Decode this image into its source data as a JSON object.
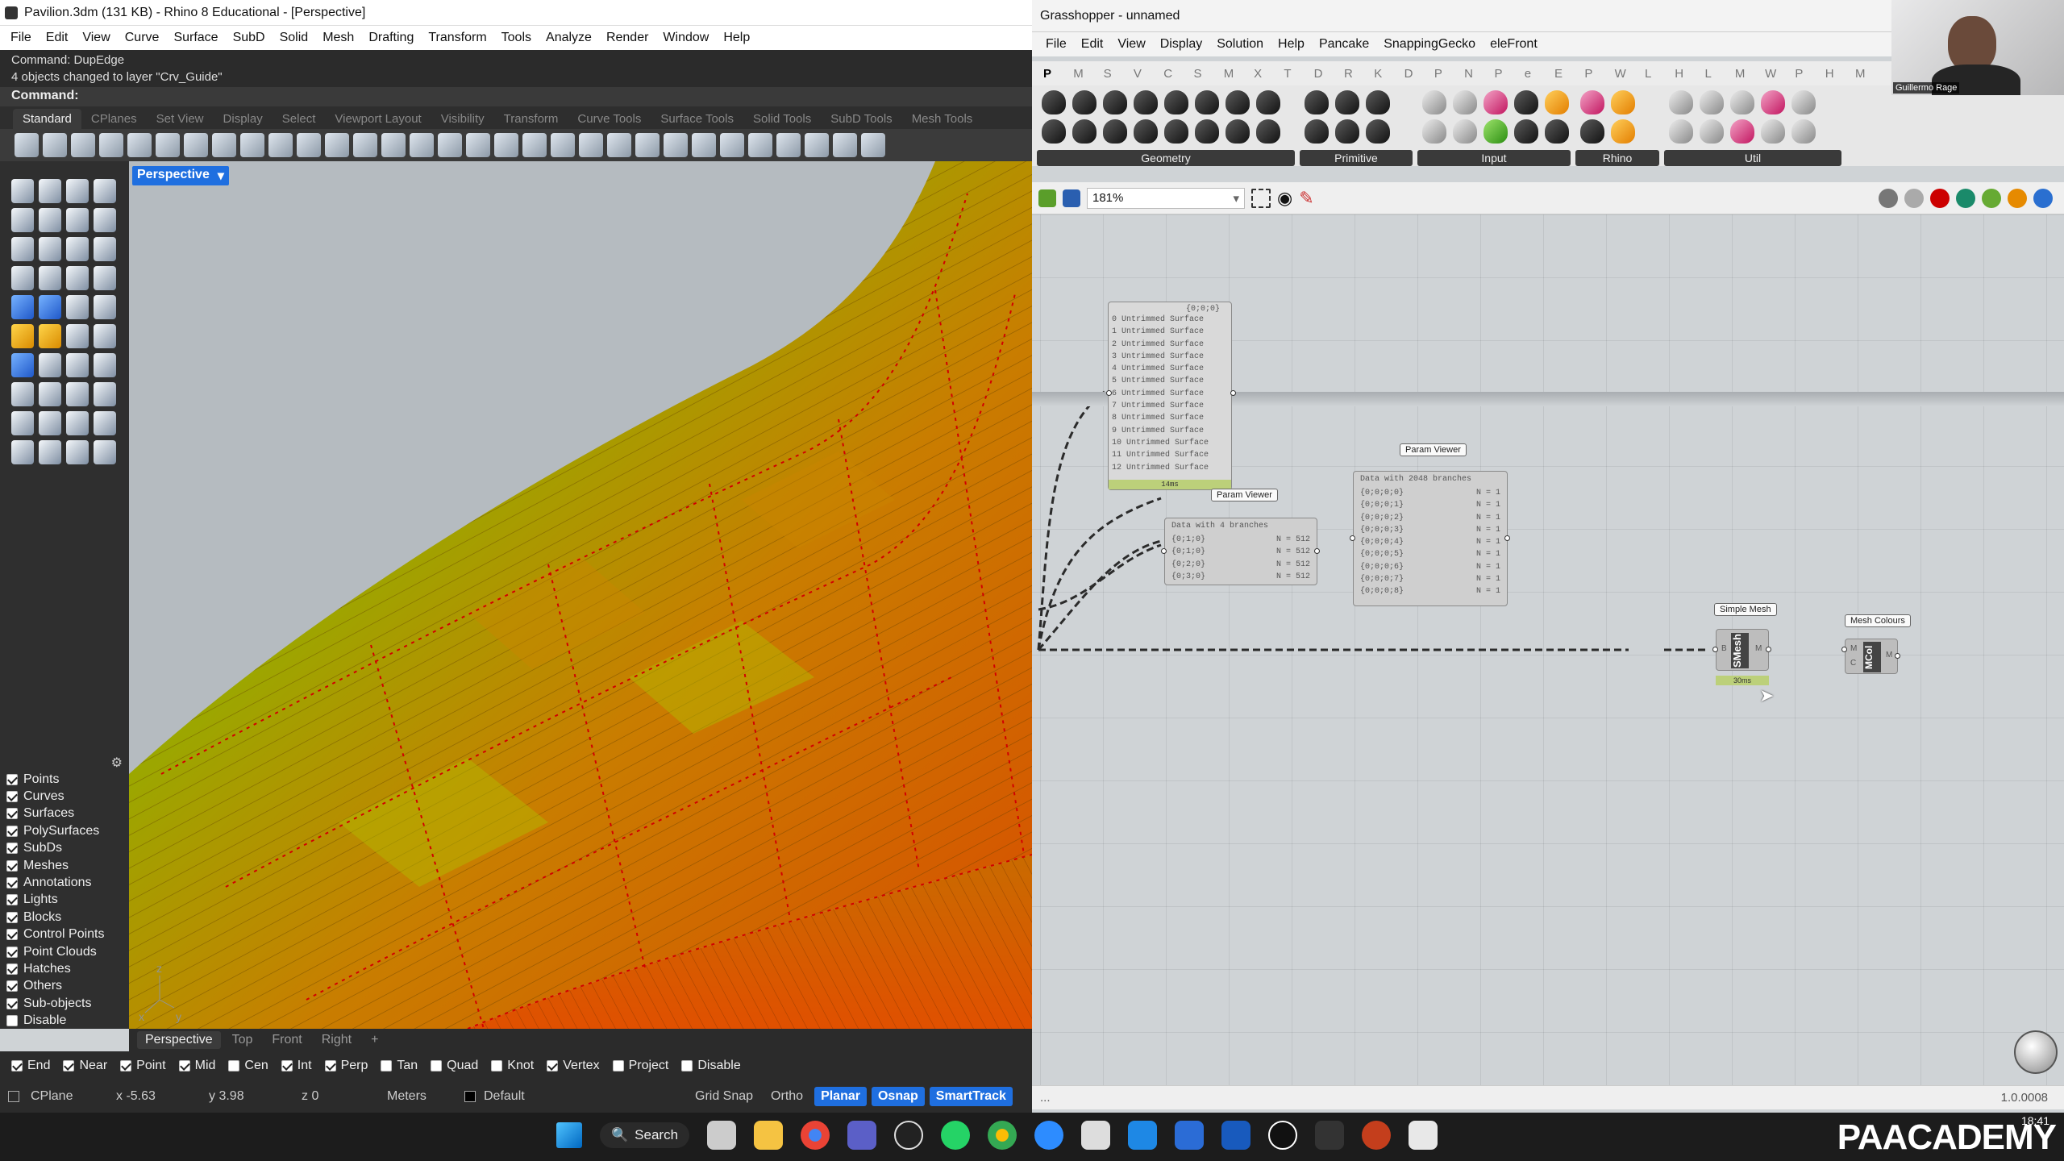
{
  "rhino": {
    "title": "Pavilion.3dm (131 KB) - Rhino 8 Educational - [Perspective]",
    "menu": [
      "File",
      "Edit",
      "View",
      "Curve",
      "Surface",
      "SubD",
      "Solid",
      "Mesh",
      "Drafting",
      "Transform",
      "Tools",
      "Analyze",
      "Render",
      "Window",
      "Help"
    ],
    "cmd_history": [
      "Command: DupEdge",
      "4 objects changed to layer \"Crv_Guide\""
    ],
    "cmd_prompt": "Command:",
    "toolbar_tabs": [
      "Standard",
      "CPlanes",
      "Set View",
      "Display",
      "Select",
      "Viewport Layout",
      "Visibility",
      "Transform",
      "Curve Tools",
      "Surface Tools",
      "Solid Tools",
      "SubD Tools",
      "Mesh Tools"
    ],
    "viewport_name": "Perspective",
    "viewport_tabs": [
      "Perspective",
      "Top",
      "Front",
      "Right",
      "+"
    ],
    "filters": [
      {
        "label": "Points",
        "on": true
      },
      {
        "label": "Curves",
        "on": true
      },
      {
        "label": "Surfaces",
        "on": true
      },
      {
        "label": "PolySurfaces",
        "on": true
      },
      {
        "label": "SubDs",
        "on": true
      },
      {
        "label": "Meshes",
        "on": true
      },
      {
        "label": "Annotations",
        "on": true
      },
      {
        "label": "Lights",
        "on": true
      },
      {
        "label": "Blocks",
        "on": true
      },
      {
        "label": "Control Points",
        "on": true
      },
      {
        "label": "Point Clouds",
        "on": true
      },
      {
        "label": "Hatches",
        "on": true
      },
      {
        "label": "Others",
        "on": true
      },
      {
        "label": "Sub-objects",
        "on": true
      },
      {
        "label": "Disable",
        "on": false
      }
    ],
    "osnaps": [
      {
        "label": "End",
        "on": true
      },
      {
        "label": "Near",
        "on": true
      },
      {
        "label": "Point",
        "on": true
      },
      {
        "label": "Mid",
        "on": true
      },
      {
        "label": "Cen",
        "on": false
      },
      {
        "label": "Int",
        "on": true
      },
      {
        "label": "Perp",
        "on": true
      },
      {
        "label": "Tan",
        "on": false
      },
      {
        "label": "Quad",
        "on": false
      },
      {
        "label": "Knot",
        "on": false
      },
      {
        "label": "Vertex",
        "on": true
      },
      {
        "label": "Project",
        "on": false
      },
      {
        "label": "Disable",
        "on": false
      }
    ],
    "status": {
      "cplane": "CPlane",
      "x": "x -5.63",
      "y": "y 3.98",
      "z": "z 0",
      "units": "Meters",
      "layer": "Default",
      "grid_snap": "Grid Snap",
      "ortho": "Ortho",
      "planar": "Planar",
      "osnap": "Osnap",
      "smarttrack": "SmartTrack"
    }
  },
  "gh": {
    "title": "Grasshopper - unnamed",
    "menu": [
      "File",
      "Edit",
      "View",
      "Display",
      "Solution",
      "Help",
      "Pancake",
      "SnappingGecko",
      "eleFront"
    ],
    "tabs": [
      "P",
      "M",
      "S",
      "V",
      "C",
      "S",
      "M",
      "X",
      "T",
      "D",
      "R",
      "K",
      "D",
      "P",
      "N",
      "P",
      "e",
      "E",
      "P",
      "W",
      "L",
      "H",
      "L",
      "M",
      "W",
      "P",
      "H",
      "M"
    ],
    "groups": [
      "Geometry",
      "Primitive",
      "Input",
      "Rhino",
      "Util"
    ],
    "zoom": "181%",
    "panel": {
      "header": "{0;0;0}",
      "items": [
        "0 Untrimmed Surface",
        "1 Untrimmed Surface",
        "2 Untrimmed Surface",
        "3 Untrimmed Surface",
        "4 Untrimmed Surface",
        "5 Untrimmed Surface",
        "6 Untrimmed Surface",
        "7 Untrimmed Surface",
        "8 Untrimmed Surface",
        "9 Untrimmed Surface",
        "10 Untrimmed Surface",
        "11 Untrimmed Surface",
        "12 Untrimmed Surface"
      ],
      "footer": "14ms"
    },
    "pv1": {
      "label": "Param Viewer",
      "title": "Data with 4 branches",
      "rows": [
        {
          "k": "{0;1;0}",
          "v": "N = 512"
        },
        {
          "k": "{0;1;0}",
          "v": "N = 512"
        },
        {
          "k": "{0;2;0}",
          "v": "N = 512"
        },
        {
          "k": "{0;3;0}",
          "v": "N = 512"
        }
      ]
    },
    "pv2": {
      "label": "Param Viewer",
      "title": "Data with 2048 branches",
      "rows": [
        {
          "k": "{0;0;0;0}",
          "v": "N = 1"
        },
        {
          "k": "{0;0;0;1}",
          "v": "N = 1"
        },
        {
          "k": "{0;0;0;2}",
          "v": "N = 1"
        },
        {
          "k": "{0;0;0;3}",
          "v": "N = 1"
        },
        {
          "k": "{0;0;0;4}",
          "v": "N = 1"
        },
        {
          "k": "{0;0;0;5}",
          "v": "N = 1"
        },
        {
          "k": "{0;0;0;6}",
          "v": "N = 1"
        },
        {
          "k": "{0;0;0;7}",
          "v": "N = 1"
        },
        {
          "k": "{0;0;0;8}",
          "v": "N = 1"
        }
      ]
    },
    "smesh": {
      "label": "Simple Mesh",
      "name": "SMesh",
      "in": "B",
      "out": "M",
      "time": "30ms"
    },
    "mcol": {
      "label": "Mesh Colours",
      "name": "MCol",
      "in1": "M",
      "in2": "C",
      "out": "M"
    },
    "version": "1.0.0008",
    "status_left": "..."
  },
  "cam": {
    "name": "Guillermo Rage"
  },
  "taskbar": {
    "search": "Search",
    "time": "18:41",
    "brand": "PAACADEMY"
  }
}
